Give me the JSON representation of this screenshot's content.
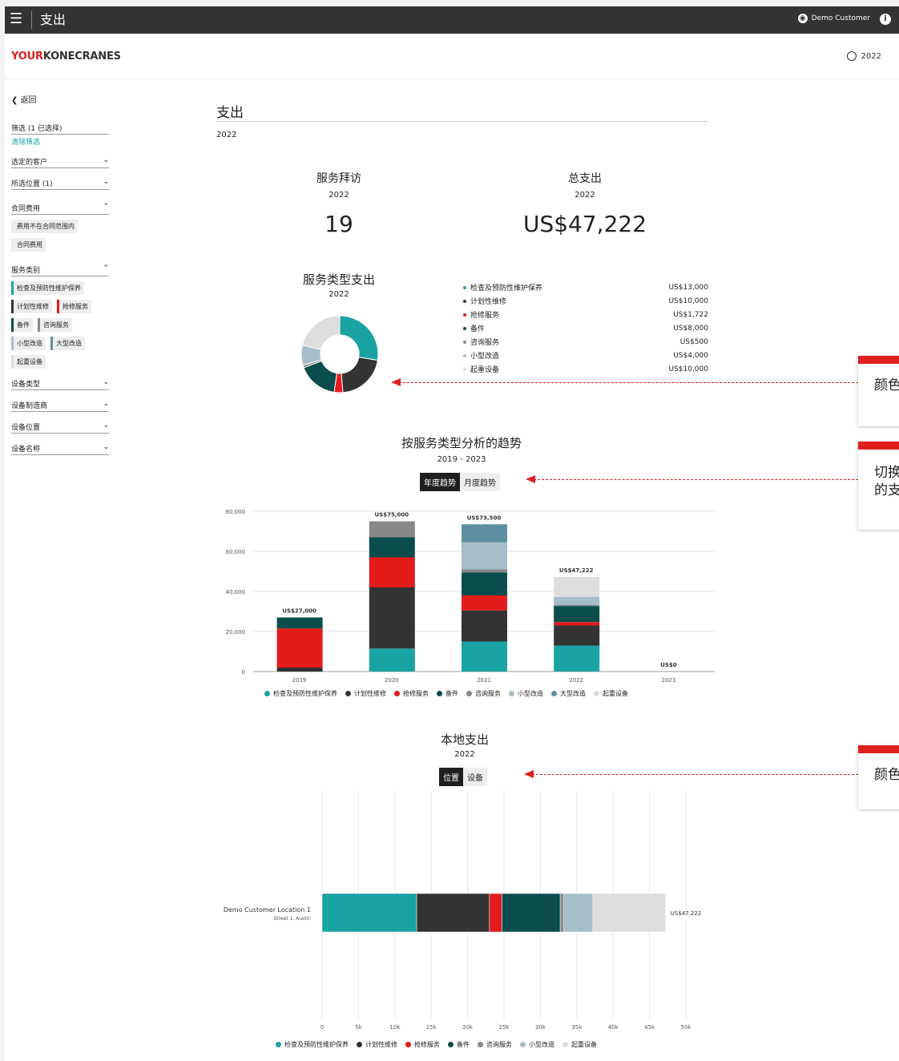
{
  "topbar": {
    "title": "支出",
    "user": "Demo Customer",
    "menu_icon": "☰",
    "info_icon": "i"
  },
  "logo": {
    "part1": "YOUR",
    "part2": "KONECRANES"
  },
  "year_selector": "2022",
  "sidebar": {
    "back": "返回",
    "filter_header": "筛选 (1 已选择)",
    "clear": "清除筛选",
    "dropdowns": [
      {
        "label": "选定的客户"
      },
      {
        "label": "所选位置 (1)"
      }
    ],
    "contract": {
      "label": "合同费用",
      "chips": [
        "费用不在合同范围内",
        "合同费用"
      ]
    },
    "service": {
      "label": "服务类别",
      "chips": [
        {
          "label": "检查及预防性维护保养",
          "color": "#1aa3a3"
        },
        {
          "label": "计划性维修",
          "color": "#333333"
        },
        {
          "label": "抢修服务",
          "color": "#e31b1b"
        },
        {
          "label": "备件",
          "color": "#0b4d4d"
        },
        {
          "label": "咨询服务",
          "color": "#888888"
        },
        {
          "label": "小型改造",
          "color": "#a5bec8"
        },
        {
          "label": "大型改造",
          "color": "#5d8fa0"
        },
        {
          "label": "起重设备",
          "color": "#dddddd"
        }
      ]
    },
    "bottom_dropdowns": [
      {
        "label": "设备类型"
      },
      {
        "label": "设备制造商"
      },
      {
        "label": "设备位置"
      },
      {
        "label": "设备名称"
      }
    ]
  },
  "main": {
    "title": "支出",
    "year": "2022",
    "kpi_visits": {
      "label": "服务拜访",
      "year": "2022",
      "value": "19"
    },
    "kpi_total": {
      "label": "总支出",
      "year": "2022",
      "value": "US$47,222"
    },
    "type_spend": {
      "title": "服务类型支出",
      "year": "2022"
    },
    "trend": {
      "title": "按服务类型分析的趋势",
      "years": "2019 - 2023",
      "tab_annual": "年度趋势",
      "tab_monthly": "月度趋势"
    },
    "local": {
      "title": "本地支出",
      "year": "2022",
      "tab_location": "位置",
      "tab_equipment": "设备"
    }
  },
  "annotations": [
    {
      "text": "颜色"
    },
    {
      "text": "切换\n的支"
    },
    {
      "text": "颜色"
    }
  ],
  "chart_data": [
    {
      "type": "pie",
      "title": "服务类型支出",
      "categories": [
        "检查及预防性维护保养",
        "计划性维修",
        "抢修服务",
        "备件",
        "咨询服务",
        "小型改造",
        "起重设备"
      ],
      "values": [
        13000,
        10000,
        1722,
        8000,
        500,
        4000,
        10000
      ],
      "labels": [
        "US$13,000",
        "US$10,000",
        "US$1,722",
        "US$8,000",
        "US$500",
        "US$4,000",
        "US$10,000"
      ],
      "colors": [
        "#1aa3a3",
        "#333333",
        "#e31b1b",
        "#0b4d4d",
        "#888888",
        "#a5bec8",
        "#dddddd"
      ]
    },
    {
      "type": "bar",
      "title": "按服务类型分析的趋势",
      "categories": [
        "2019",
        "2020",
        "2021",
        "2022",
        "2023"
      ],
      "ylim": [
        0,
        80000
      ],
      "yticks": [
        "0",
        "20,000",
        "40,000",
        "60,000",
        "80,000"
      ],
      "totals": [
        "US$27,000",
        "US$75,000",
        "US$73,500",
        "US$47,222",
        "US$0"
      ],
      "series": [
        {
          "name": "检查及预防性维护保养",
          "color": "#1aa3a3",
          "values": [
            0,
            11500,
            15000,
            13000,
            0
          ]
        },
        {
          "name": "计划性维修",
          "color": "#333333",
          "values": [
            2000,
            30500,
            15500,
            10000,
            0
          ]
        },
        {
          "name": "抢修服务",
          "color": "#e31b1b",
          "values": [
            19500,
            15000,
            7500,
            1722,
            0
          ]
        },
        {
          "name": "备件",
          "color": "#0b4d4d",
          "values": [
            5500,
            10000,
            11500,
            8000,
            0
          ]
        },
        {
          "name": "咨询服务",
          "color": "#888888",
          "values": [
            0,
            8000,
            1500,
            500,
            0
          ]
        },
        {
          "name": "小型改造",
          "color": "#a5bec8",
          "values": [
            0,
            0,
            13500,
            4000,
            0
          ]
        },
        {
          "name": "大型改造",
          "color": "#5d8fa0",
          "values": [
            0,
            0,
            9000,
            0,
            0
          ]
        },
        {
          "name": "起重设备",
          "color": "#dddddd",
          "values": [
            0,
            0,
            0,
            10000,
            0
          ]
        }
      ]
    },
    {
      "type": "bar",
      "title": "本地支出",
      "orientation": "horizontal",
      "categories": [
        "Demo Customer Location 1"
      ],
      "sublabels": [
        "Street 1, Austin"
      ],
      "total_label": "US$47,222",
      "xlim": [
        0,
        50000
      ],
      "xticks": [
        "0",
        "5k",
        "10k",
        "15k",
        "20k",
        "25k",
        "30k",
        "35k",
        "40k",
        "45k",
        "50k"
      ],
      "series": [
        {
          "name": "检查及预防性维护保养",
          "color": "#1aa3a3",
          "values": [
            13000
          ]
        },
        {
          "name": "计划性维修",
          "color": "#333333",
          "values": [
            10000
          ]
        },
        {
          "name": "抢修服务",
          "color": "#e31b1b",
          "values": [
            1722
          ]
        },
        {
          "name": "备件",
          "color": "#0b4d4d",
          "values": [
            8000
          ]
        },
        {
          "name": "咨询服务",
          "color": "#888888",
          "values": [
            500
          ]
        },
        {
          "name": "小型改造",
          "color": "#a5bec8",
          "values": [
            4000
          ]
        },
        {
          "name": "起重设备",
          "color": "#dddddd",
          "values": [
            10000
          ]
        }
      ]
    }
  ]
}
